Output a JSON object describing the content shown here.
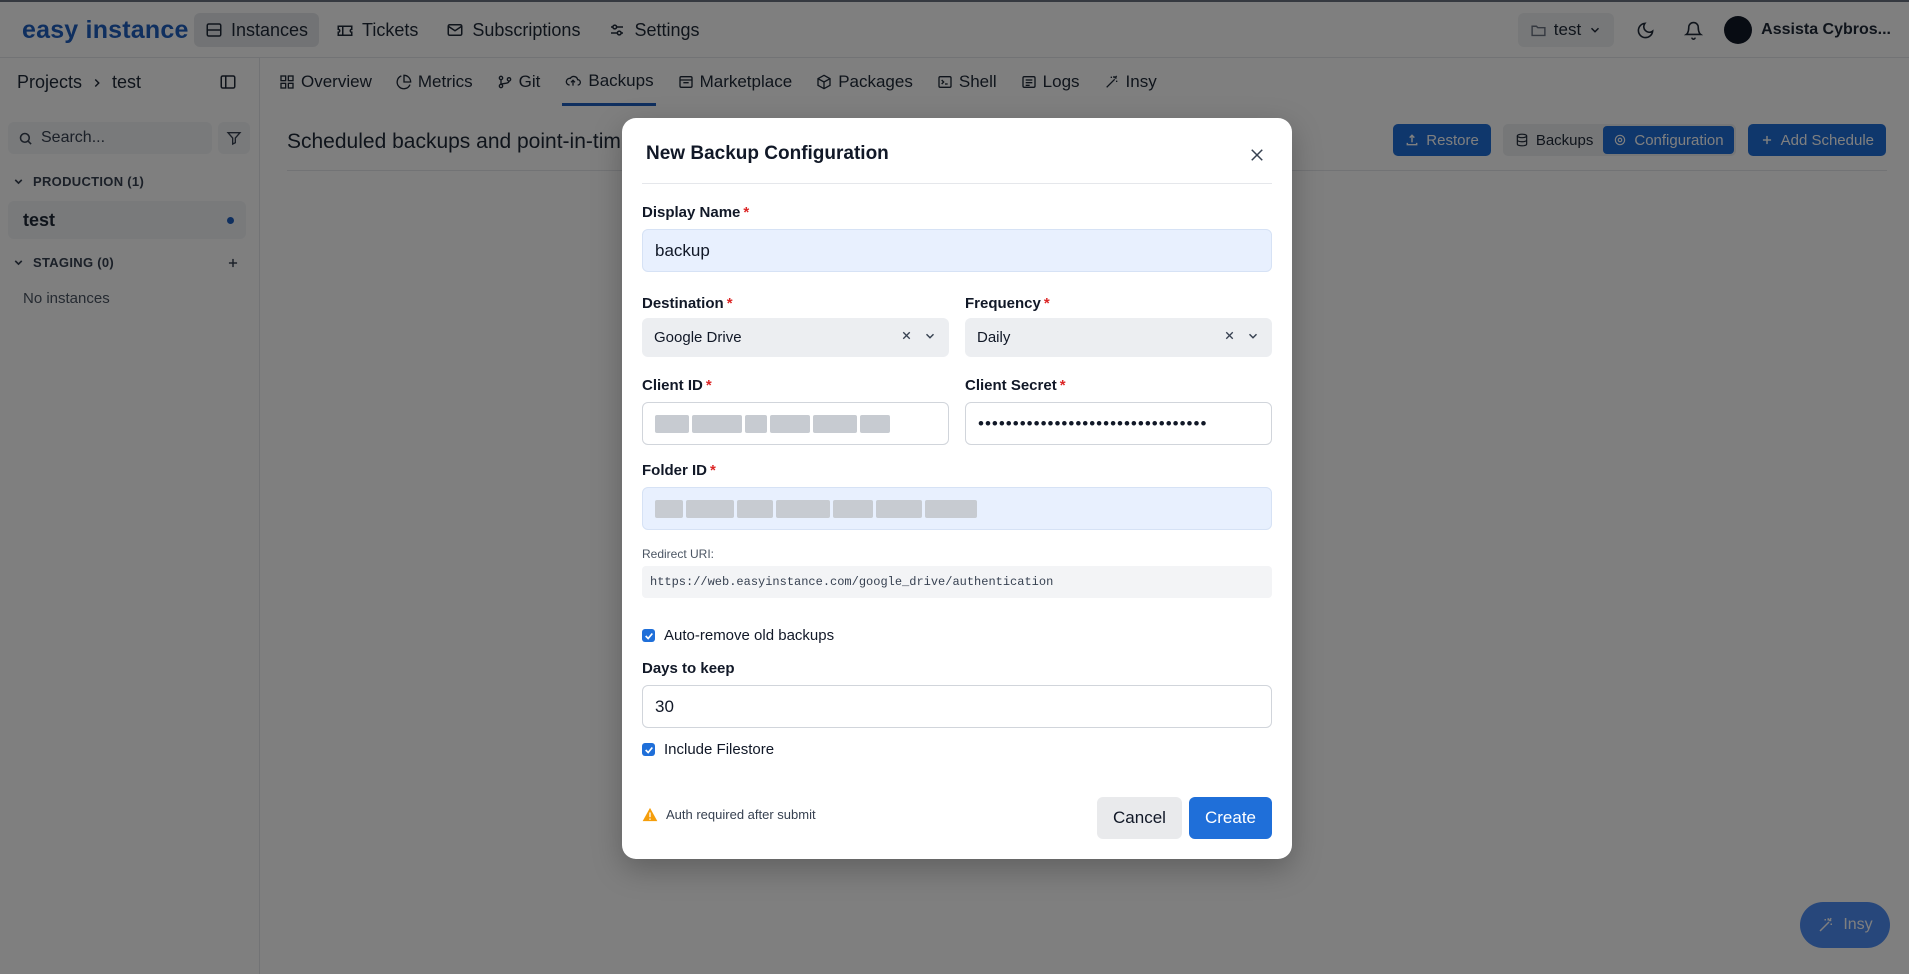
{
  "brand": {
    "logo": "easy instance"
  },
  "topnav": [
    {
      "label": "Instances",
      "icon": "server-icon",
      "active": true
    },
    {
      "label": "Tickets",
      "icon": "ticket-icon",
      "active": false
    },
    {
      "label": "Subscriptions",
      "icon": "mail-icon",
      "active": false
    },
    {
      "label": "Settings",
      "icon": "sliders-icon",
      "active": false
    }
  ],
  "topright": {
    "project": "test",
    "user": "Assista Cybros..."
  },
  "sidebar": {
    "breadcrumb_root": "Projects",
    "breadcrumb_current": "test",
    "search_placeholder": "Search...",
    "groups": [
      {
        "label": "PRODUCTION (1)"
      },
      {
        "label": "STAGING (0)"
      }
    ],
    "instance": "test",
    "empty_text": "No instances"
  },
  "tabs": [
    {
      "label": "Overview",
      "icon": "grid-icon"
    },
    {
      "label": "Metrics",
      "icon": "pie-chart-icon"
    },
    {
      "label": "Git",
      "icon": "git-icon"
    },
    {
      "label": "Backups",
      "icon": "cloud-upload-icon",
      "active": true
    },
    {
      "label": "Marketplace",
      "icon": "store-icon"
    },
    {
      "label": "Packages",
      "icon": "package-icon"
    },
    {
      "label": "Shell",
      "icon": "terminal-icon"
    },
    {
      "label": "Logs",
      "icon": "list-icon"
    },
    {
      "label": "Insy",
      "icon": "magic-wand-icon"
    }
  ],
  "page": {
    "title": "Scheduled backups and point-in-tim",
    "restore_label": "Restore",
    "backups_label": "Backups",
    "configuration_label": "Configuration",
    "add_schedule_label": "Add Schedule"
  },
  "insy_fab": "Insy",
  "modal": {
    "title": "New Backup Configuration",
    "display_name_label": "Display Name",
    "display_name_value": "backup",
    "destination_label": "Destination",
    "destination_value": "Google Drive",
    "frequency_label": "Frequency",
    "frequency_value": "Daily",
    "client_id_label": "Client ID",
    "client_secret_label": "Client Secret",
    "client_secret_mask": "•••••••••••••••••••••••••••••••••",
    "folder_id_label": "Folder ID",
    "redirect_label": "Redirect URI:",
    "redirect_value": "https://web.easyinstance.com/google_drive/authentication",
    "auto_remove_label": "Auto-remove old backups",
    "auto_remove_checked": true,
    "days_label": "Days to keep",
    "days_value": "30",
    "filestore_label": "Include Filestore",
    "filestore_checked": true,
    "warning": "Auth required after submit",
    "cancel_label": "Cancel",
    "create_label": "Create"
  },
  "colors": {
    "accent": "#1f6fd9",
    "brand": "#1f5fbf",
    "required": "#dc2626",
    "warning": "#f59e0b"
  }
}
